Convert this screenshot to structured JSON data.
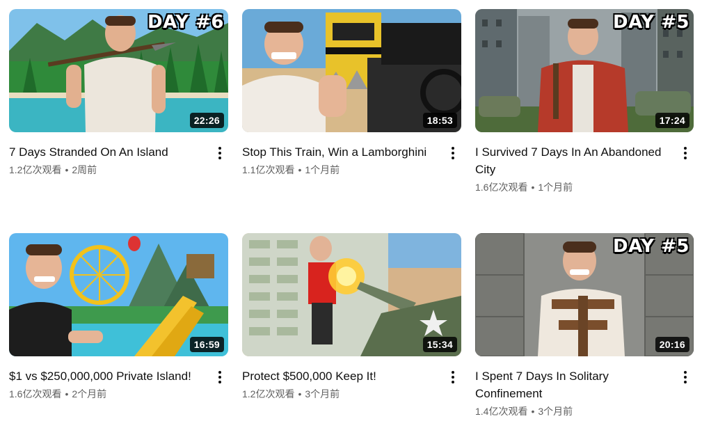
{
  "videos": [
    {
      "title": "7 Days Stranded On An Island",
      "views": "1.2亿次观看",
      "age": "2周前",
      "duration": "22:26",
      "badge": "DAY #6"
    },
    {
      "title": "Stop This Train, Win a Lamborghini",
      "views": "1.1亿次观看",
      "age": "1个月前",
      "duration": "18:53",
      "badge": ""
    },
    {
      "title": "I Survived 7 Days In An Abandoned City",
      "views": "1.6亿次观看",
      "age": "1个月前",
      "duration": "17:24",
      "badge": "DAY #5"
    },
    {
      "title": "$1 vs $250,000,000 Private Island!",
      "views": "1.6亿次观看",
      "age": "2个月前",
      "duration": "16:59",
      "badge": ""
    },
    {
      "title": "Protect $500,000 Keep It!",
      "views": "1.2亿次观看",
      "age": "3个月前",
      "duration": "15:34",
      "badge": ""
    },
    {
      "title": "I Spent 7 Days In Solitary Confinement",
      "views": "1.4亿次观看",
      "age": "3个月前",
      "duration": "20:16",
      "badge": "DAY #5"
    }
  ],
  "separator": "•",
  "icons": {
    "more": "more-vert-icon"
  }
}
